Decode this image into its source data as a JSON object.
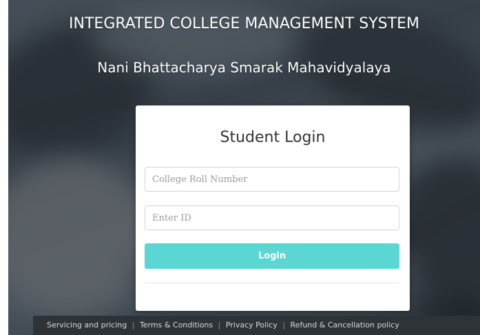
{
  "header": {
    "title": "INTEGRATED COLLEGE MANAGEMENT SYSTEM",
    "subtitle": "Nani Bhattacharya Smarak Mahavidyalaya"
  },
  "login": {
    "heading": "Student Login",
    "roll_placeholder": "College Roll Number",
    "roll_value": "",
    "id_placeholder": "Enter ID",
    "id_value": "",
    "button_label": "Login"
  },
  "footer": {
    "links": [
      "Servicing and pricing",
      "Terms & Conditions",
      "Privacy Policy",
      "Refund & Cancellation policy"
    ],
    "separator": "|"
  },
  "colors": {
    "button": "#5cd6d3",
    "footer_bg": "#2e3338"
  }
}
